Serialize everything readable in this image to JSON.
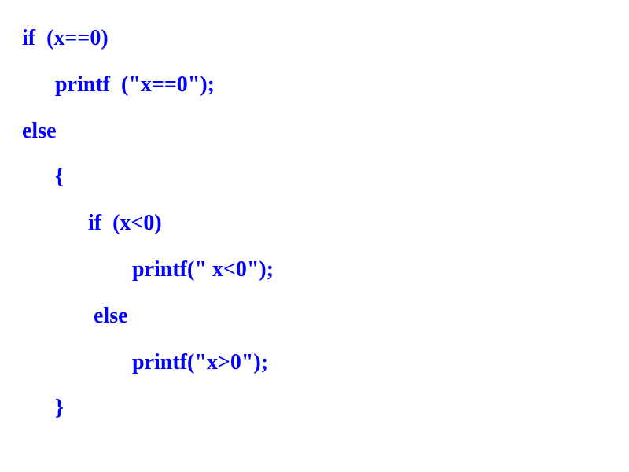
{
  "code": {
    "line1": "if  (x==0)",
    "line2": "      printf  (\"x==0\");",
    "line3": "else",
    "line4": "      {",
    "line5": "            if  (x<0)",
    "line6": "                    printf(\" x<0\");",
    "line7": "             else",
    "line8": "                    printf(\"x>0\");",
    "line9": "      }"
  }
}
